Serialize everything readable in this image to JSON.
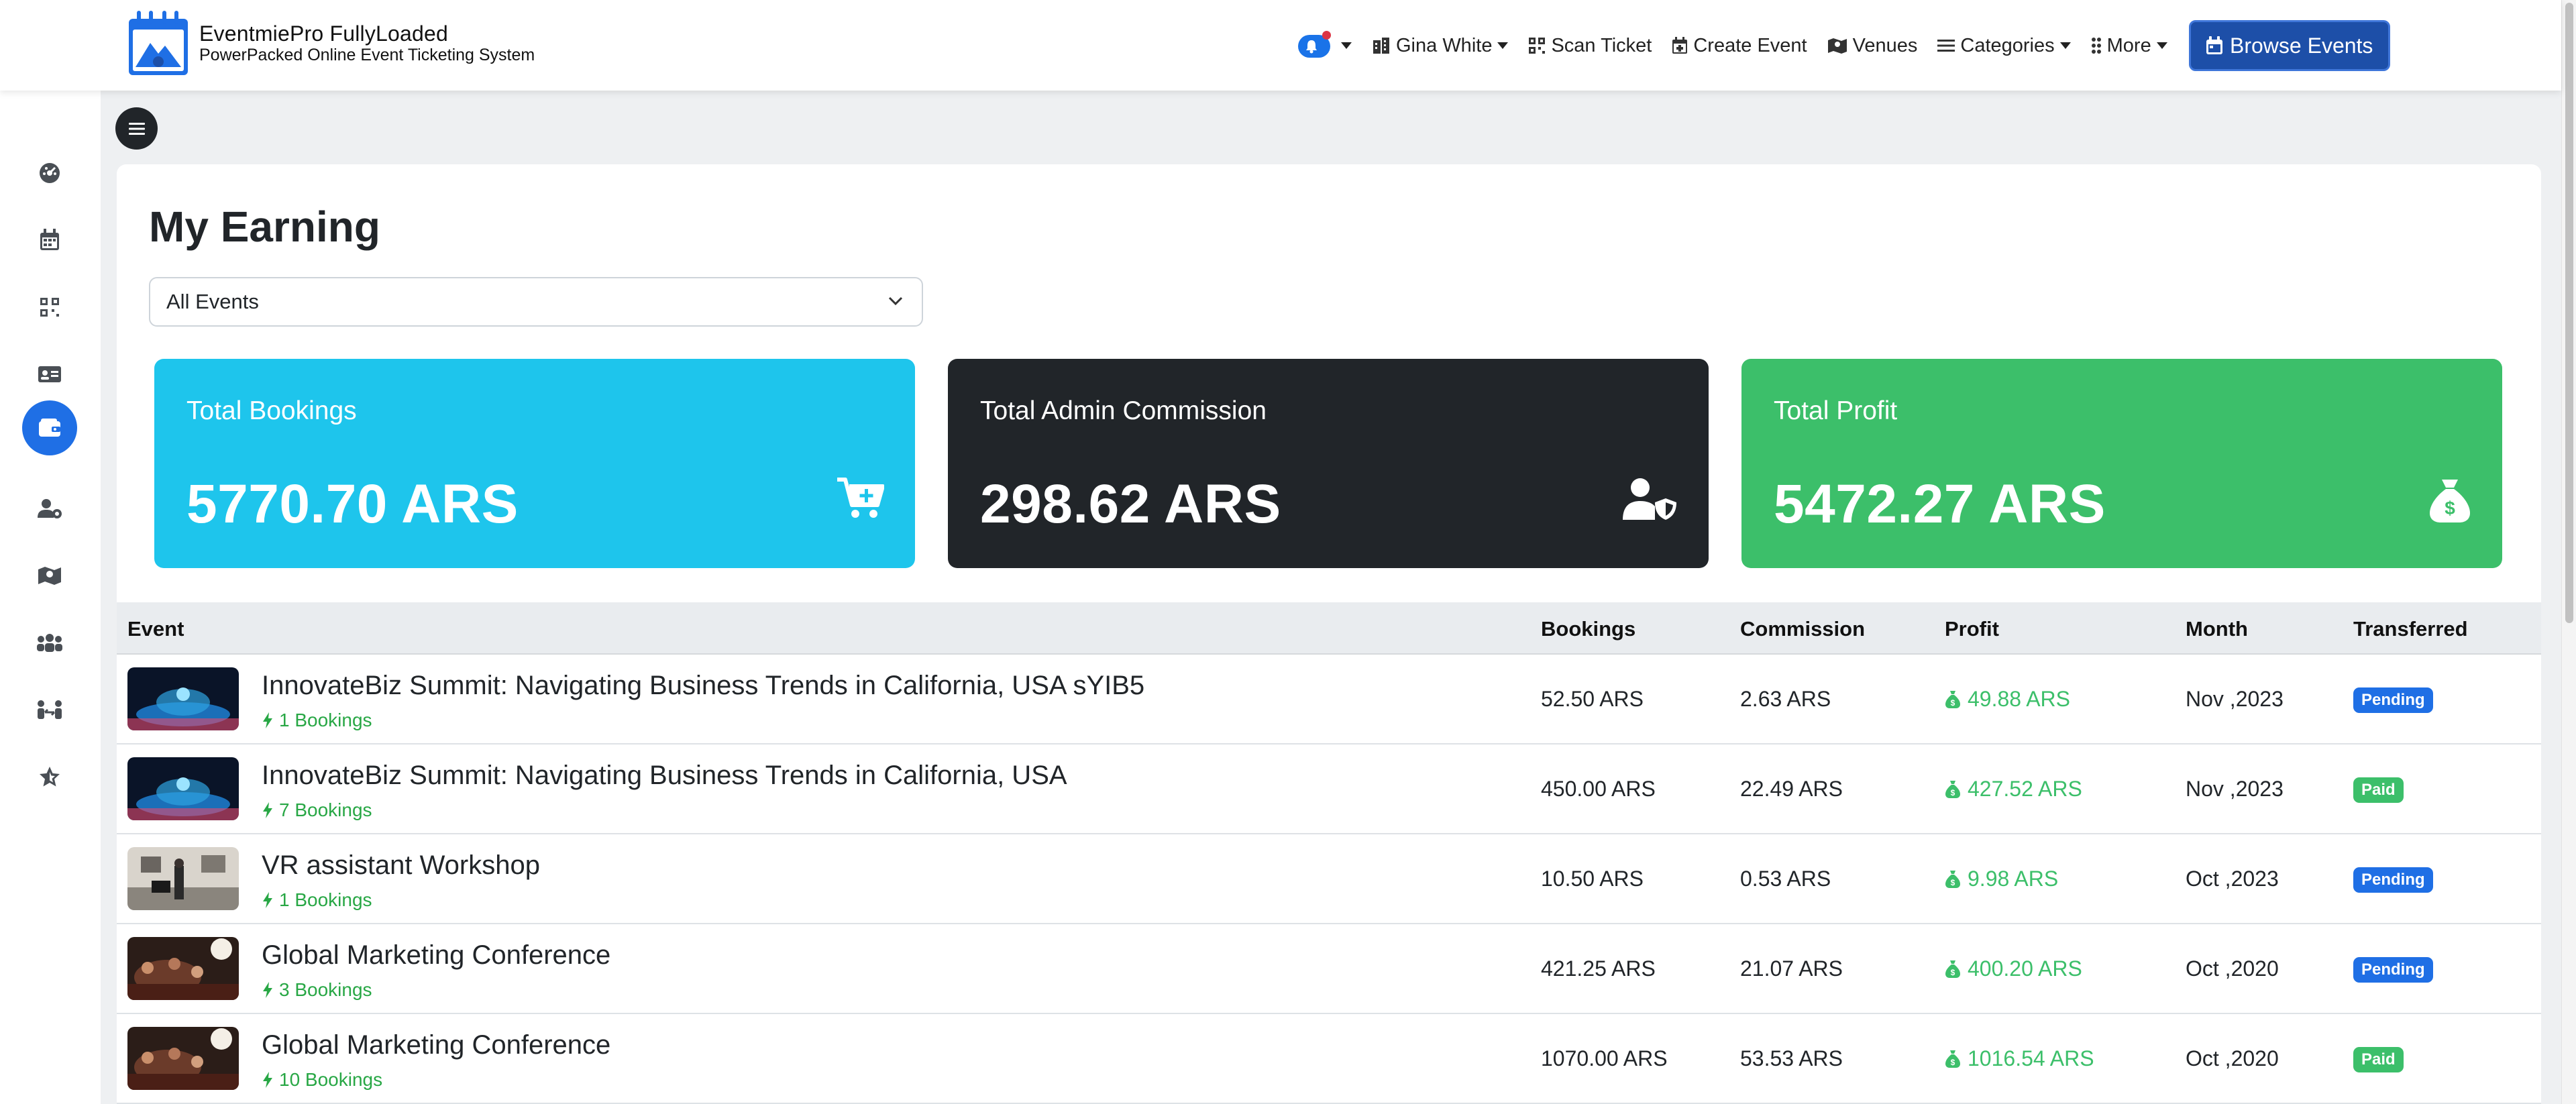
{
  "app": {
    "brand_title": "EventmiePro FullyLoaded",
    "brand_subtitle": "PowerPacked Online Event Ticketing System"
  },
  "nav": {
    "user_label": "Gina White",
    "scan_ticket_label": "Scan Ticket",
    "create_event_label": "Create Event",
    "venues_label": "Venues",
    "categories_label": "Categories",
    "more_label": "More",
    "browse_events_label": "Browse Events"
  },
  "sidebar": {
    "items": [
      {
        "icon": "dashboard-icon",
        "active": false
      },
      {
        "icon": "calendar-icon",
        "active": false
      },
      {
        "icon": "qr-code-icon",
        "active": false
      },
      {
        "icon": "id-card-icon",
        "active": false
      },
      {
        "icon": "wallet-icon",
        "active": true
      },
      {
        "icon": "user-gear-icon",
        "active": false
      },
      {
        "icon": "map-icon",
        "active": false
      },
      {
        "icon": "users-icon",
        "active": false
      },
      {
        "icon": "people-arrows-icon",
        "active": false
      },
      {
        "icon": "star-icon",
        "active": false
      }
    ]
  },
  "page": {
    "title": "My Earning",
    "filter_selected": "All Events"
  },
  "stats": {
    "bookings_label": "Total Bookings",
    "bookings_value": "5770.70 ARS",
    "commission_label": "Total Admin Commission",
    "commission_value": "298.62 ARS",
    "profit_label": "Total Profit",
    "profit_value": "5472.27 ARS"
  },
  "table": {
    "headers": {
      "event": "Event",
      "bookings": "Bookings",
      "commission": "Commission",
      "profit": "Profit",
      "month": "Month",
      "transferred": "Transferred"
    },
    "rows": [
      {
        "title": "InnovateBiz Summit: Navigating Business Trends in California, USA sYIB5",
        "count": "1 Bookings",
        "bookings": "52.50 ARS",
        "commission": "2.63 ARS",
        "profit": "49.88 ARS",
        "month": "Nov ,2023",
        "status": "Pending"
      },
      {
        "title": "InnovateBiz Summit: Navigating Business Trends in California, USA",
        "count": "7 Bookings",
        "bookings": "450.00 ARS",
        "commission": "22.49 ARS",
        "profit": "427.52 ARS",
        "month": "Nov ,2023",
        "status": "Paid"
      },
      {
        "title": "VR assistant Workshop",
        "count": "1 Bookings",
        "bookings": "10.50 ARS",
        "commission": "0.53 ARS",
        "profit": "9.98 ARS",
        "month": "Oct ,2023",
        "status": "Pending"
      },
      {
        "title": "Global Marketing Conference",
        "count": "3 Bookings",
        "bookings": "421.25 ARS",
        "commission": "21.07 ARS",
        "profit": "400.20 ARS",
        "month": "Oct ,2020",
        "status": "Pending"
      },
      {
        "title": "Global Marketing Conference",
        "count": "10 Bookings",
        "bookings": "1070.00 ARS",
        "commission": "53.53 ARS",
        "profit": "1016.54 ARS",
        "month": "Oct ,2020",
        "status": "Paid"
      }
    ]
  },
  "colors": {
    "blue_card": "#1ec5ec",
    "dark_card": "#212529",
    "green_card": "#3cbf6a",
    "primary": "#1f6fe5",
    "brand_button": "#1d4fa8"
  }
}
